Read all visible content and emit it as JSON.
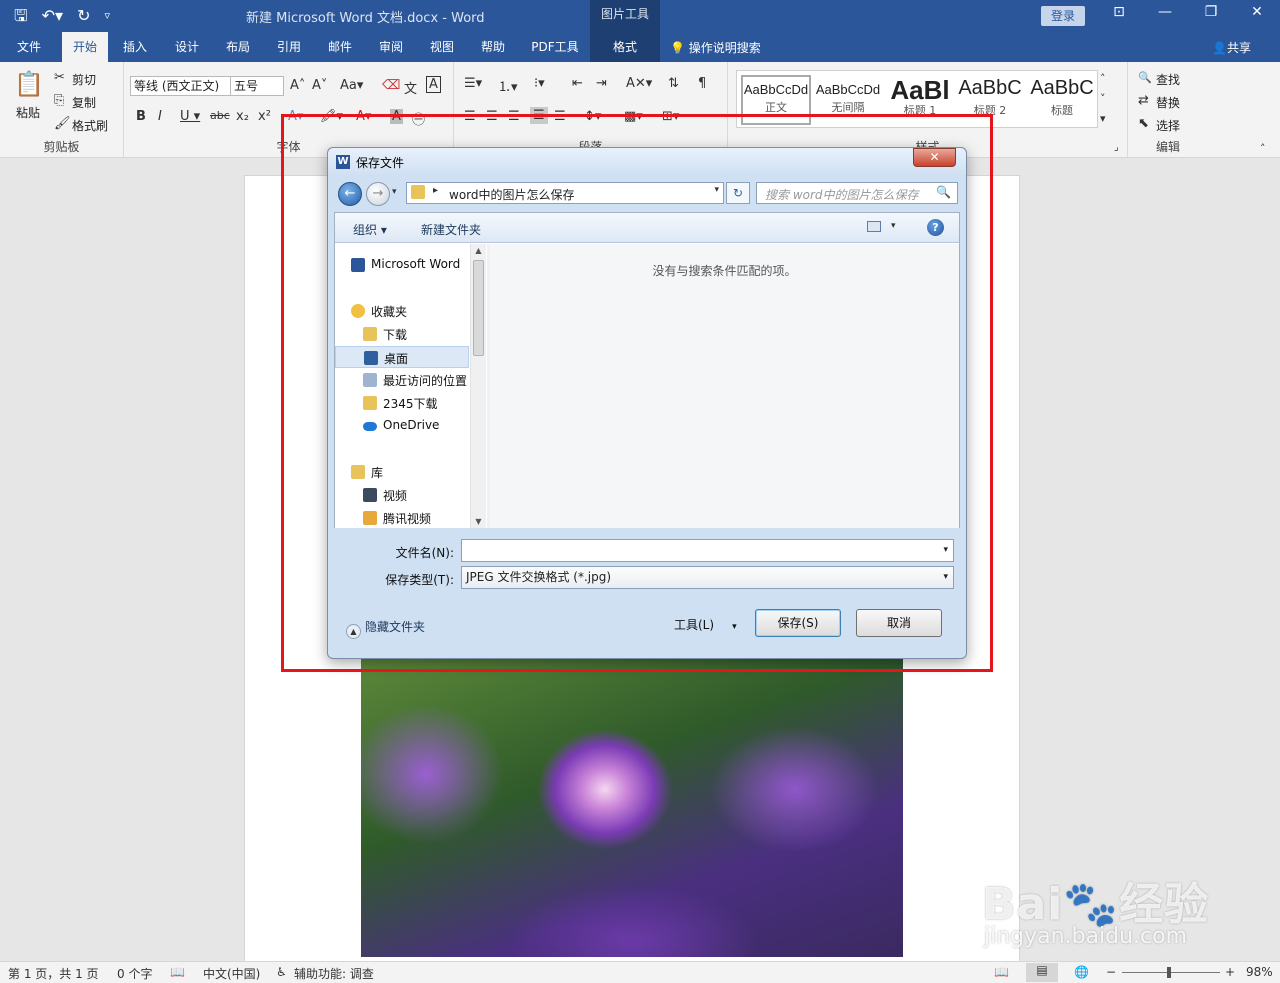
{
  "titlebar": {
    "doc_title": "新建 Microsoft Word 文档.docx  -  Word",
    "context_tab": "图片工具",
    "login": "登录",
    "qat": {
      "save": "🖫",
      "undo": "↶▾",
      "redo": "↻",
      "customize": "▿"
    },
    "controls": {
      "ribbon_display": "⊡",
      "minimize": "—",
      "restore": "❐",
      "close": "✕"
    }
  },
  "tabs": {
    "file": "文件",
    "home": "开始",
    "insert": "插入",
    "design": "设计",
    "layout": "布局",
    "references": "引用",
    "mailings": "邮件",
    "review": "审阅",
    "view": "视图",
    "help": "帮助",
    "pdf": "PDF工具",
    "format": "格式",
    "tellme": "操作说明搜索",
    "share": "共享",
    "tellme_icon": "💡",
    "share_icon": "👤"
  },
  "ribbon": {
    "clipboard": {
      "paste": "粘贴",
      "cut": "剪切",
      "copy": "复制",
      "format_painter": "格式刷",
      "label": "剪贴板",
      "icons": {
        "paste": "📋",
        "cut": "✂",
        "copy": "⎘",
        "format_painter": "🖌"
      }
    },
    "font": {
      "font_name": "等线 (西文正文)",
      "font_size": "五号",
      "label": "字体",
      "icons": {
        "grow": "A˄",
        "shrink": "A˅",
        "case": "Aa▾",
        "clear": "⌫",
        "phonetic": "文",
        "border": "A",
        "bold": "B",
        "italic": "I",
        "underline": "U ▾",
        "strike": "abc",
        "subscript": "x₂",
        "superscript": "x²",
        "effects": "A▾",
        "highlight": "🖍▾",
        "color": "A▾",
        "shading": "A",
        "enclose": "㊀"
      }
    },
    "paragraph": {
      "label": "段落",
      "icons": {
        "bullets": "☰▾",
        "numbering": "⒈▾",
        "multilevel": "⁝▾",
        "decrease_indent": "⇤",
        "increase_indent": "⇥",
        "chinese_layout": "A✕▾",
        "sort": "⇅",
        "marks": "¶",
        "align_left": "☰",
        "center": "☰",
        "align_right": "☰",
        "justify": "☰",
        "distribute": "☰",
        "line_spacing": "↕▾",
        "shading": "▩▾",
        "borders": "⊞▾"
      }
    },
    "styles": {
      "label": "样式",
      "items": [
        {
          "sample": "AaBbCcDd",
          "name": "正文"
        },
        {
          "sample": "AaBbCcDd",
          "name": "无间隔"
        },
        {
          "sample": "AaBl",
          "name": "标题 1"
        },
        {
          "sample": "AaBbC",
          "name": "标题 2"
        },
        {
          "sample": "AaBbC",
          "name": "标题"
        }
      ],
      "gallery_icons": {
        "up": "˄",
        "down": "˅",
        "more": "▾"
      }
    },
    "editing": {
      "find": "查找",
      "replace": "替换",
      "select": "选择",
      "label": "编辑",
      "icons": {
        "find": "🔍",
        "replace": "⇄",
        "select": "⬉"
      }
    },
    "launcher": "⌟",
    "collapse": "˄"
  },
  "dialog": {
    "title": "保存文件",
    "app_icon_letter": "W",
    "close_glyph": "✕",
    "path_folder": "word中的图片怎么保存",
    "search_placeholder": "搜索 word中的图片怎么保存",
    "glyphs": {
      "back": "←",
      "forward": "→",
      "drop": "▾",
      "sep": "▸",
      "refresh": "↻",
      "search": "🔍",
      "help": "?",
      "scroll_up": "▲",
      "scroll_down": "▼",
      "collapse": "▲"
    },
    "toolbar": {
      "organize": "组织 ▾",
      "new_folder": "新建文件夹"
    },
    "nav": [
      {
        "label": "Microsoft Word"
      },
      {
        "label": "收藏夹"
      },
      {
        "label": "下载"
      },
      {
        "label": "桌面"
      },
      {
        "label": "最近访问的位置"
      },
      {
        "label": "2345下载"
      },
      {
        "label": "OneDrive"
      },
      {
        "label": "库"
      },
      {
        "label": "视频"
      },
      {
        "label": "腾讯视频"
      }
    ],
    "empty_message": "没有与搜索条件匹配的项。",
    "filename_label": "文件名(N):",
    "filename_value": "",
    "filetype_label": "保存类型(T):",
    "filetype_value": "JPEG 文件交换格式 (*.jpg)",
    "hide_folders": "隐藏文件夹",
    "tools": "工具(L)",
    "save": "保存(S)",
    "cancel": "取消"
  },
  "watermark": {
    "main": "Bai🐾经验",
    "sub": "jingyan.baidu.com"
  },
  "statusbar": {
    "page": "第 1 页，共 1 页",
    "words": "0 个字",
    "proof_icon": "📖",
    "language": "中文(中国)",
    "accessibility": "辅助功能: 调查",
    "accessibility_icon": "♿",
    "view_read": "📖",
    "view_print": "▤",
    "view_web": "🌐",
    "zoom_out": "−",
    "zoom_in": "+",
    "zoom": "98%"
  },
  "colors": {
    "word_blue": "#2b579a",
    "highlight_red": "#e8141b"
  }
}
